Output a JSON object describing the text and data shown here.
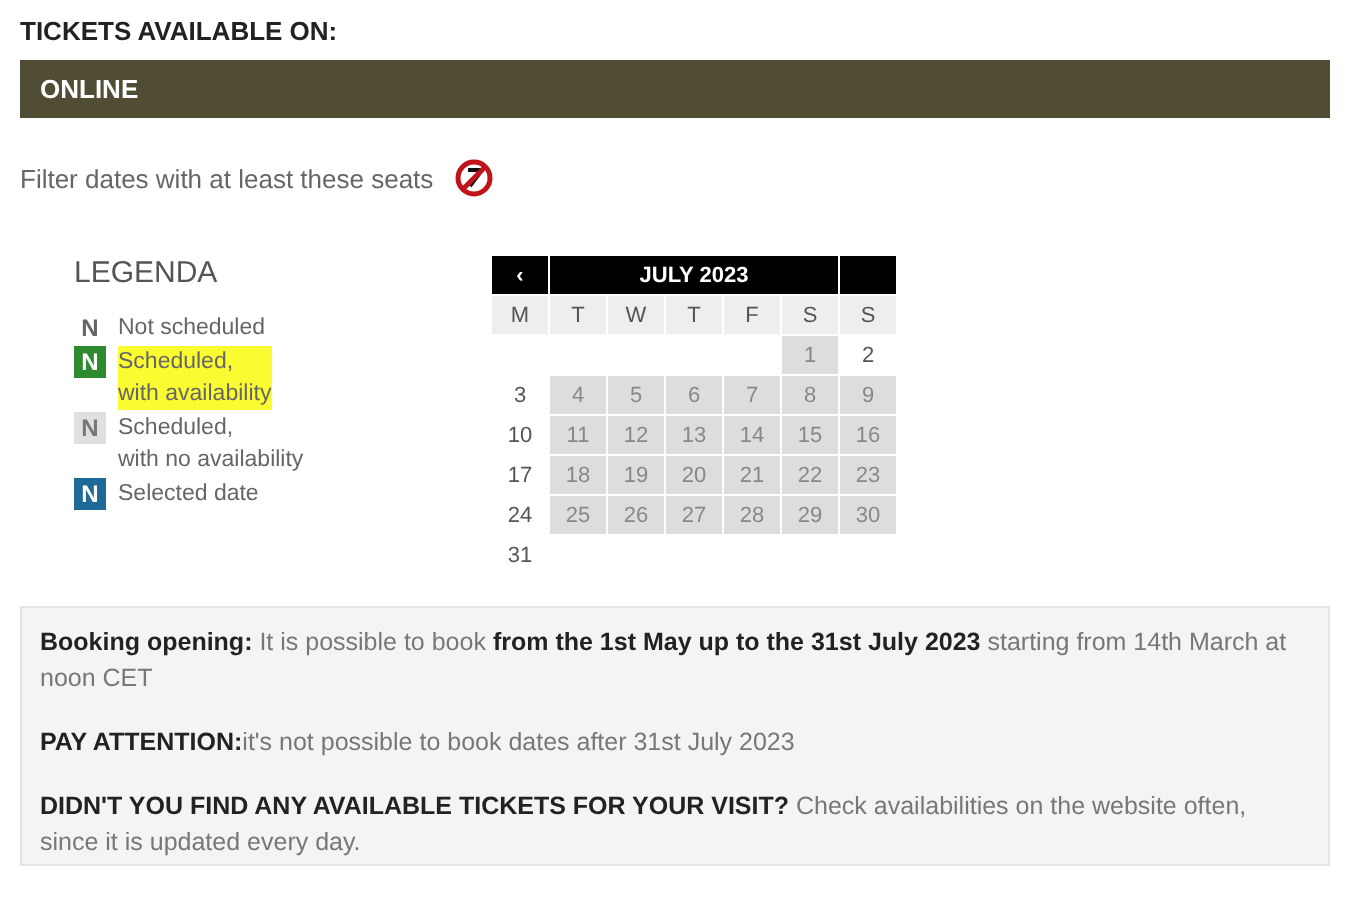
{
  "heading": "TICKETS AVAILABLE ON:",
  "channel_bar": {
    "label": "ONLINE"
  },
  "filter": {
    "label": "Filter dates with at least these seats"
  },
  "legend": {
    "title": "LEGENDA",
    "items": [
      {
        "swatch": "N",
        "kind": "plain",
        "lines": [
          "Not scheduled"
        ],
        "highlighted": false
      },
      {
        "swatch": "N",
        "kind": "available",
        "lines": [
          "Scheduled,",
          "with availability"
        ],
        "highlighted": true
      },
      {
        "swatch": "N",
        "kind": "full",
        "lines": [
          "Scheduled,",
          "with no availability"
        ],
        "highlighted": false
      },
      {
        "swatch": "N",
        "kind": "selected",
        "lines": [
          "Selected date"
        ],
        "highlighted": false
      }
    ]
  },
  "calendar": {
    "prev": "‹",
    "month": "JULY 2023",
    "weekdays": [
      "M",
      "T",
      "W",
      "T",
      "F",
      "S",
      "S"
    ],
    "weeks": [
      [
        {
          "day": "1",
          "scheduled": true
        },
        {
          "day": "2",
          "scheduled": false
        }
      ],
      [
        {
          "day": "3",
          "scheduled": false
        },
        {
          "day": "4",
          "scheduled": true
        },
        {
          "day": "5",
          "scheduled": true
        },
        {
          "day": "6",
          "scheduled": true
        },
        {
          "day": "7",
          "scheduled": true
        },
        {
          "day": "8",
          "scheduled": true
        },
        {
          "day": "9",
          "scheduled": true
        }
      ],
      [
        {
          "day": "10",
          "scheduled": false
        },
        {
          "day": "11",
          "scheduled": true
        },
        {
          "day": "12",
          "scheduled": true
        },
        {
          "day": "13",
          "scheduled": true
        },
        {
          "day": "14",
          "scheduled": true
        },
        {
          "day": "15",
          "scheduled": true
        },
        {
          "day": "16",
          "scheduled": true
        }
      ],
      [
        {
          "day": "17",
          "scheduled": false
        },
        {
          "day": "18",
          "scheduled": true
        },
        {
          "day": "19",
          "scheduled": true
        },
        {
          "day": "20",
          "scheduled": true
        },
        {
          "day": "21",
          "scheduled": true
        },
        {
          "day": "22",
          "scheduled": true
        },
        {
          "day": "23",
          "scheduled": true
        }
      ],
      [
        {
          "day": "24",
          "scheduled": false
        },
        {
          "day": "25",
          "scheduled": true
        },
        {
          "day": "26",
          "scheduled": true
        },
        {
          "day": "27",
          "scheduled": true
        },
        {
          "day": "28",
          "scheduled": true
        },
        {
          "day": "29",
          "scheduled": true
        },
        {
          "day": "30",
          "scheduled": true
        }
      ],
      [
        {
          "day": "31",
          "scheduled": false
        }
      ]
    ]
  },
  "info": [
    "**Booking opening:** It is possible to book **from the 1st May up to the 31st July 2023** starting from 14th March at noon CET",
    "**PAY ATTENTION:**it's not possible to book dates after 31st July 2023",
    "**DIDN'T YOU FIND ANY AVAILABLE TICKETS FOR YOUR VISIT?** Check availabilities on the website often, since it is updated every day."
  ]
}
